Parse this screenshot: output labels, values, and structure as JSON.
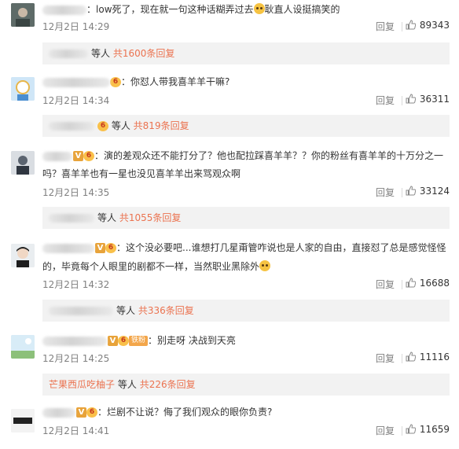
{
  "comments": [
    {
      "text_a": "low死了，现在就一句这种话糊弄过去",
      "text_b": "耿直人设挺搞笑的",
      "time": "12月2日 14:29",
      "reply": "回复",
      "likes": "89343",
      "sub": {
        "people": "等人",
        "count": "共1600条回复"
      }
    },
    {
      "text": "你怼人带我喜羊羊干嘛?",
      "time": "12月2日 14:34",
      "reply": "回复",
      "likes": "36311",
      "sub": {
        "people": "等人",
        "count": "共819条回复"
      }
    },
    {
      "text_a": "演的差观众还不能打分了？他也配拉踩喜羊羊？？你的粉丝有喜羊羊的十万分之一",
      "text_b": "吗？喜羊羊也有一星也没见喜羊羊出来骂观众啊",
      "time": "12月2日 14:35",
      "reply": "回复",
      "likes": "33124",
      "sub": {
        "people": "等人",
        "count": "共1055条回复"
      }
    },
    {
      "text_a": "这个没必要吧...谁想打几星甭管咋说也是人家的自由，直接怼了总是感觉怪怪",
      "text_b": "的，毕竟每个人眼里的剧都不一样，当然职业黑除外",
      "time": "12月2日 14:32",
      "reply": "回复",
      "likes": "16688",
      "sub": {
        "people": "等人",
        "count": "共336条回复"
      }
    },
    {
      "fan_badge": "铁粉",
      "text": "别走呀 决战到天亮",
      "time": "12月2日 14:25",
      "reply": "回复",
      "likes": "11116",
      "sub": {
        "named": "芒果西瓜吃柚子",
        "people": "等人",
        "count": "共226条回复"
      }
    },
    {
      "text": "烂剧不让说？侮了我们观众的眼你负责?",
      "time": "12月2日 14:41",
      "reply": "回复",
      "likes": "11659"
    }
  ],
  "badges": {
    "v": "V",
    "orange": "6"
  },
  "colors": {
    "accent": "#eb7350",
    "muted": "#808080",
    "replybg": "#f2f2f2"
  },
  "icons": [
    "thumb-up-icon",
    "laugh-emoji-icon",
    "vip-badge-icon",
    "member-badge-icon"
  ]
}
